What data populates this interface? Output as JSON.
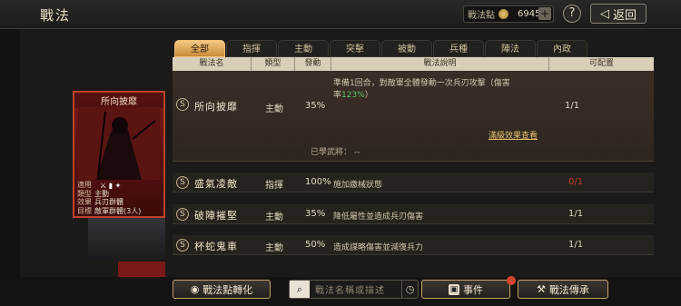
{
  "header": {
    "title": "戰法",
    "points_label": "戰法點",
    "points_value": "6945",
    "plus": "+",
    "help": "?",
    "back_label": "返回"
  },
  "tabs": [
    "全部",
    "指揮",
    "主動",
    "突擊",
    "被動",
    "兵種",
    "陣法",
    "內政"
  ],
  "active_tab": "全部",
  "columns": [
    "戰法名",
    "類型",
    "發動",
    "戰法說明",
    "可配置"
  ],
  "card": {
    "name": "所向披靡",
    "info": [
      {
        "k": "適用",
        "v": ""
      },
      {
        "k": "類型",
        "v": "主動"
      },
      {
        "k": "效果",
        "v": "兵刃群體"
      },
      {
        "k": "目標",
        "v": "敵軍群體(3人)"
      }
    ]
  },
  "featured": {
    "badge": "S",
    "name": "所向披靡",
    "type": "主動",
    "rate": "35%",
    "desc_line1": "準備1回合，對敵軍全體發動一次兵刃攻擊（傷害",
    "desc_line2_prefix": "率",
    "desc_line2_value": "123%",
    "desc_line2_suffix": "）",
    "config": "1/1",
    "link": "滿級效果查看",
    "learned": "已學武將：  --"
  },
  "rows": [
    {
      "badge": "S",
      "name": "盛氣凌敵",
      "type": "指揮",
      "rate": "100%",
      "desc": "施加繳械狀態",
      "config": "0/1"
    },
    {
      "badge": "S",
      "name": "破陣摧堅",
      "type": "主動",
      "rate": "35%",
      "desc": "降低屬性並造成兵刃傷害",
      "config": "1/1"
    },
    {
      "badge": "S",
      "name": "杯蛇鬼車",
      "type": "主動",
      "rate": "50%",
      "desc": "造成謀略傷害並減復兵力",
      "config": "1/1"
    }
  ],
  "bottom": {
    "convert_label": "戰法點轉化",
    "search_placeholder": "戰法名稱或描述",
    "event_label": "事件",
    "inherit_label": "戰法傳承"
  },
  "colors": {
    "active_tab": "#e0a85a",
    "accent_red": "#c13a28",
    "highlight_green": "#5fc06a",
    "link_gold": "#e2c06e"
  }
}
